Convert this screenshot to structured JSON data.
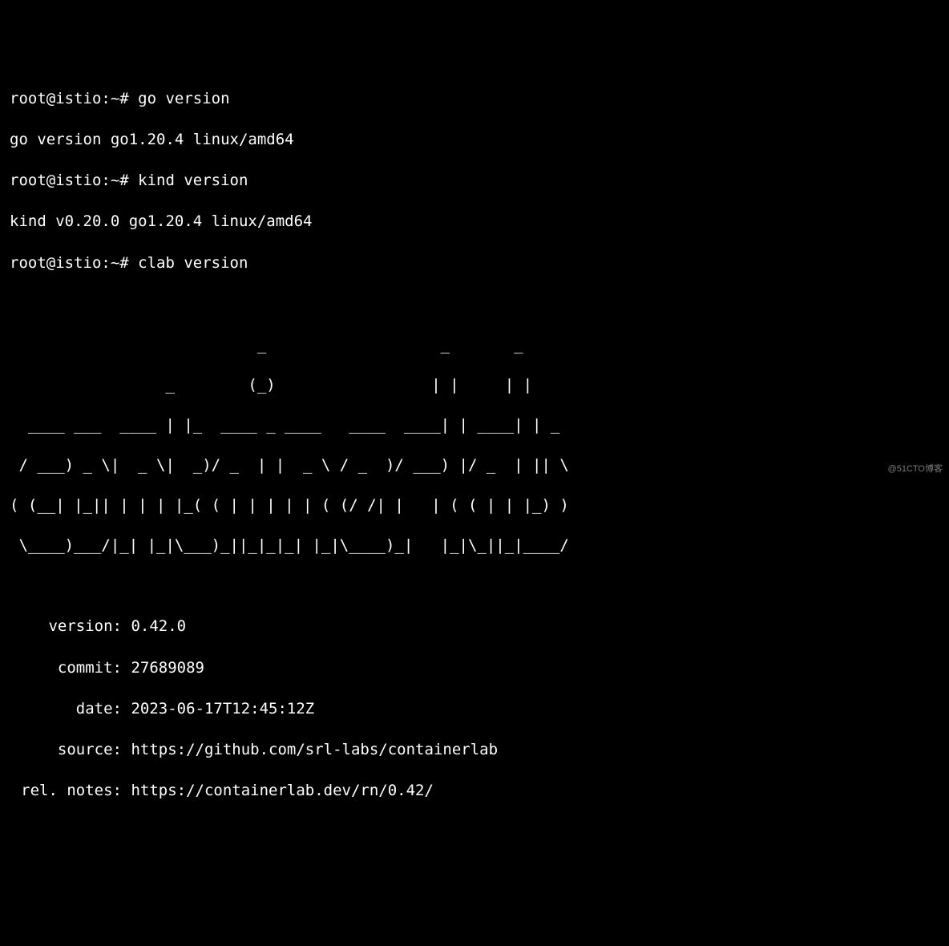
{
  "prompt": "root@istio:~#",
  "commands": {
    "go_cmd": "go version",
    "go_out": "go version go1.20.4 linux/amd64",
    "kind_cmd": "kind version",
    "kind_out": "kind v0.20.0 go1.20.4 linux/amd64",
    "clab_cmd": "clab version"
  },
  "ascii_art": [
    "                           _                   _       _     ",
    "                 _        (_)                 | |     | |    ",
    "  ____ ___  ____ | |_  ____ _ ____   ____  ____| | ____| | _  ",
    " / ___) _ \\|  _ \\|  _)/ _  | |  _ \\ / _  )/ ___) |/ _  | || \\ ",
    "( (__| |_|| | | | |_( ( | | | | | ( (/ /| |   | ( ( | | |_) )",
    " \\____)___/|_| |_|\\___)_||_|_|_| |_|\\____)_|   |_|\\_||_|____/",
    "",
    ""
  ],
  "info": {
    "version_label": "version:",
    "version": "0.42.0",
    "commit_label": "commit:",
    "commit": "27689089",
    "date_label": "date:",
    "date": "2023-06-17T12:45:12Z",
    "source_label": "source:",
    "source": "https://github.com/srl-labs/containerlab",
    "relnotes_label": "rel. notes:",
    "relnotes": "https://containerlab.dev/rn/0.42/"
  },
  "watermark": "@51CTO博客"
}
